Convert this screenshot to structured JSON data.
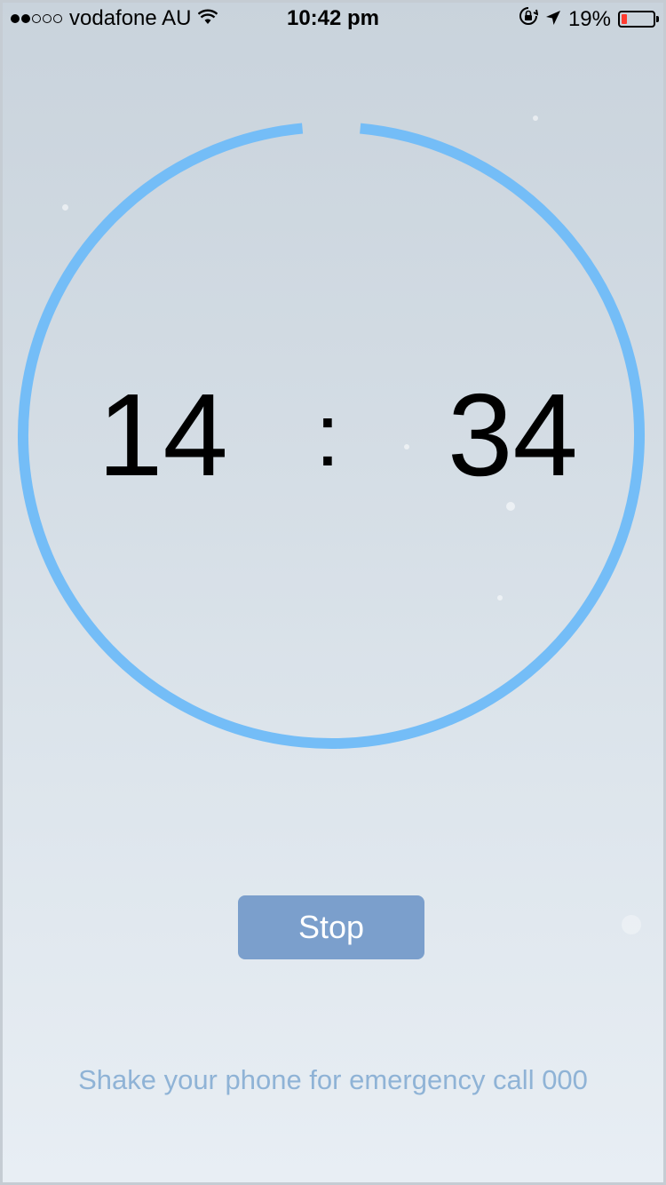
{
  "status_bar": {
    "carrier": "vodafone AU",
    "time": "10:42 pm",
    "battery_text": "19%",
    "battery_level": 0.19,
    "signal_bars_filled": 2,
    "signal_bars_total": 5,
    "icons": [
      "signal-icon",
      "wifi-icon",
      "orientation-lock-icon",
      "location-arrow-icon",
      "battery-icon"
    ]
  },
  "timer": {
    "minutes": "14",
    "separator": ":",
    "seconds": "34",
    "progress_remaining": 0.97,
    "ring_color": "#74bdf7"
  },
  "stop_button": {
    "label": "Stop",
    "color": "#7b9fcc"
  },
  "hint_text": "Shake your phone for emergency call 000"
}
